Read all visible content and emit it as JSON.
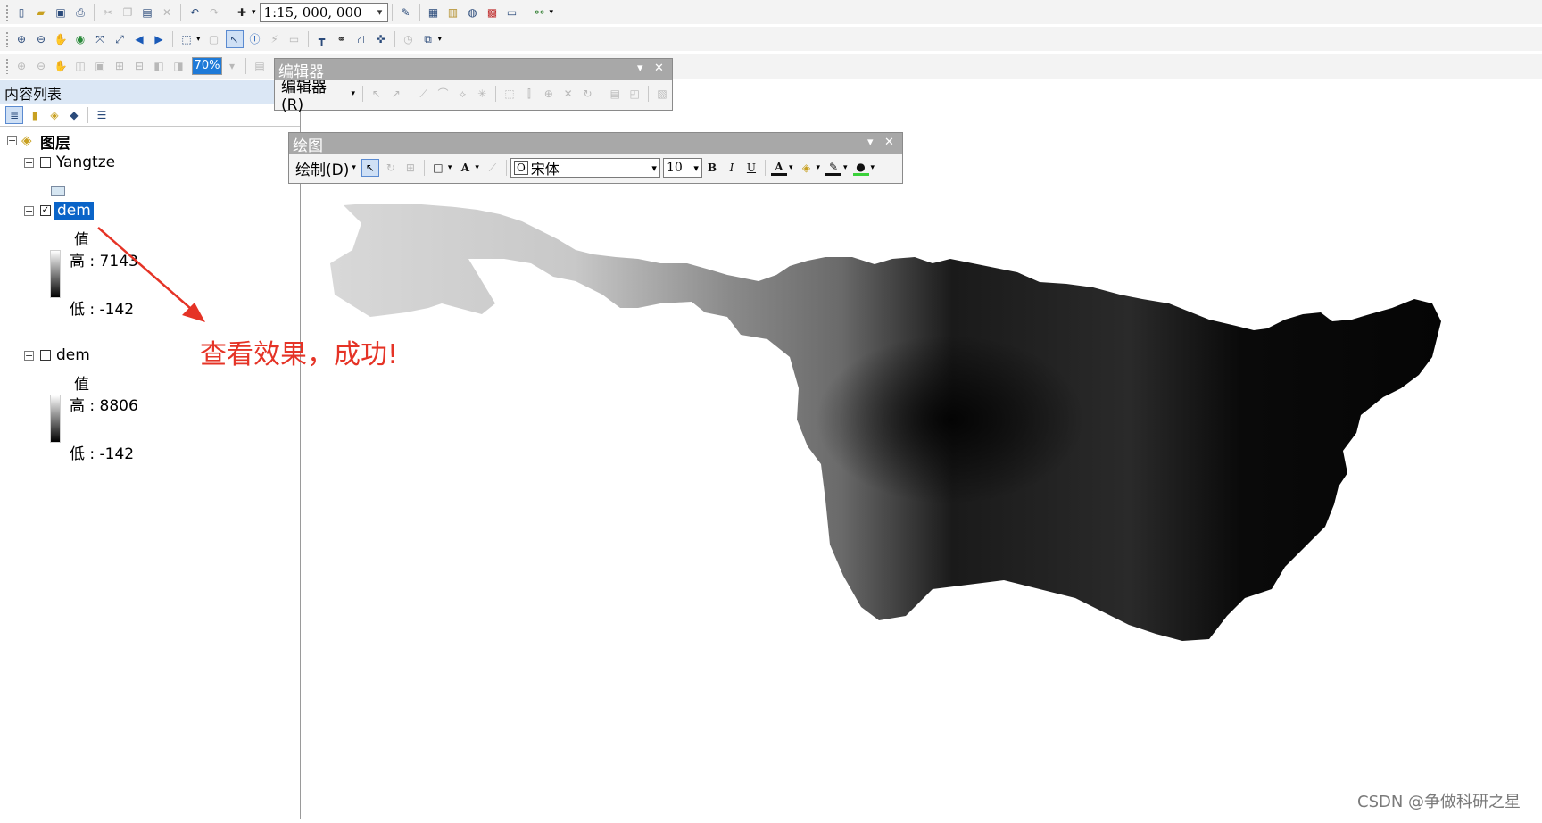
{
  "toolbar": {
    "scale_value": "1:15, 000, 000",
    "zoom_percent": "70%"
  },
  "toc": {
    "title": "内容列表",
    "root_label": "图层",
    "layers": [
      {
        "name": "Yangtze",
        "checked": false
      },
      {
        "name": "dem",
        "checked": true,
        "selected": true,
        "legend_title": "值",
        "high": "高 : 7143",
        "low": "低 : -142"
      },
      {
        "name": "dem",
        "checked": false,
        "legend_title": "值",
        "high": "高 : 8806",
        "low": "低 : -142"
      }
    ]
  },
  "editor": {
    "title": "编辑器",
    "menu_label": "编辑器(R)"
  },
  "draw": {
    "title": "绘图",
    "menu_label": "绘制(D)",
    "font_name": "宋体",
    "font_size": "10",
    "bold": "B",
    "italic": "I",
    "underline": "U",
    "font_color_letter": "A",
    "text_tool_letter": "A"
  },
  "annotation": {
    "text": "查看效果，成功!",
    "color": "#e53326"
  },
  "watermark": "CSDN @争做科研之星",
  "colors": {
    "selection": "#0a64c8",
    "title_bar": "#a8a8a8",
    "toc_header": "#dbe7f5"
  }
}
